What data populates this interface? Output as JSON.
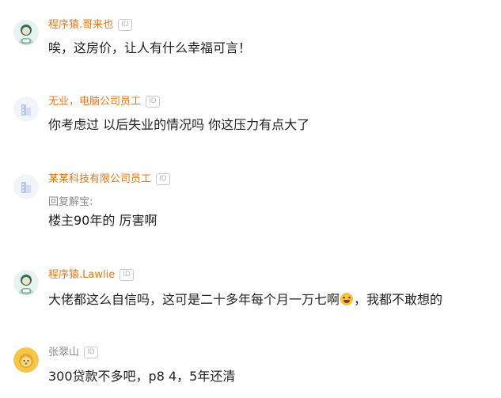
{
  "id_badge_label": "ID",
  "comments": [
    {
      "username": "程序猿.哥来也",
      "text": "唉，这房价，让人有什么幸福可言！"
    },
    {
      "username": "无业，电脑公司员工",
      "text": "你考虑过 以后失业的情况吗 你这压力有点大了"
    },
    {
      "username": "某某科技有限公司员工",
      "reply_to": "回复解宝:",
      "text": "楼主90年的 厉害啊"
    },
    {
      "username": "程序猿.Lawlie",
      "text_before_emoji": "大佬都这么自信吗，这可是二十多年每个月一万七啊",
      "emoji_icon": "laughing-tears-emoji",
      "text_after_emoji": "，我都不敢想的"
    },
    {
      "username": "张翠山",
      "text": "300贷款不多吧，p8 4，5年还清"
    }
  ],
  "colors": {
    "username_orange": "#e7761b",
    "username_gray": "#8a8a8a",
    "text": "#222222"
  }
}
